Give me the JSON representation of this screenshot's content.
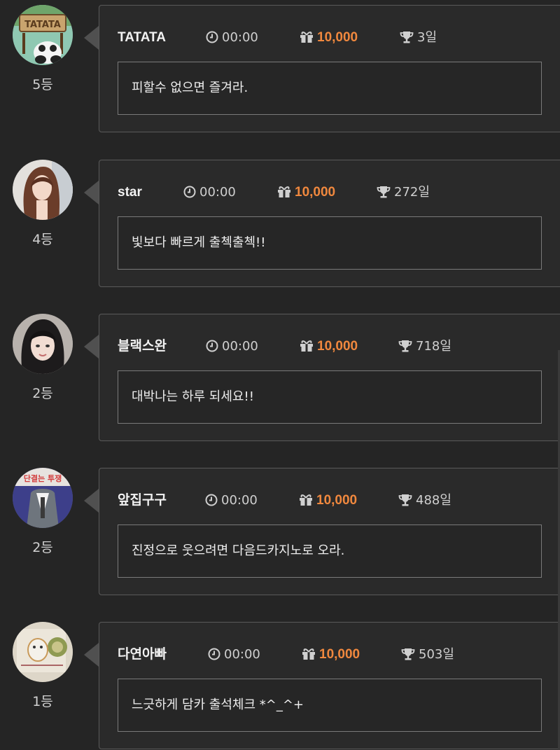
{
  "entries": [
    {
      "nickname": "TATATA",
      "time": "00:00",
      "points": "10,000",
      "days": "3일",
      "message": "피할수 없으면 즐겨라.",
      "rank": "5등"
    },
    {
      "nickname": "star",
      "time": "00:00",
      "points": "10,000",
      "days": "272일",
      "message": "빛보다 빠르게 출첵출첵!!",
      "rank": "4등"
    },
    {
      "nickname": "블랙스완",
      "time": "00:00",
      "points": "10,000",
      "days": "718일",
      "message": "대박나는 하루 되세요!!",
      "rank": "2등"
    },
    {
      "nickname": "앞집구구",
      "time": "00:00",
      "points": "10,000",
      "days": "488일",
      "message": "진정으로 웃으려면 다음드카지노로 오라.",
      "rank": "2등"
    },
    {
      "nickname": "다연아빠",
      "time": "00:00",
      "points": "10,000",
      "days": "503일",
      "message": "느긋하게 담카 출석체크 *^_^+",
      "rank": "1등"
    }
  ],
  "colors": {
    "points": "#f0883e",
    "background": "#252525",
    "card_border": "#5a5a5a"
  },
  "icons": {
    "time": "clock-icon",
    "points": "gift-icon",
    "days": "trophy-icon"
  },
  "avatars": {
    "0": {
      "sign_text": "TATATA"
    },
    "3": {
      "sign_text": "단결는 투쟁"
    }
  }
}
